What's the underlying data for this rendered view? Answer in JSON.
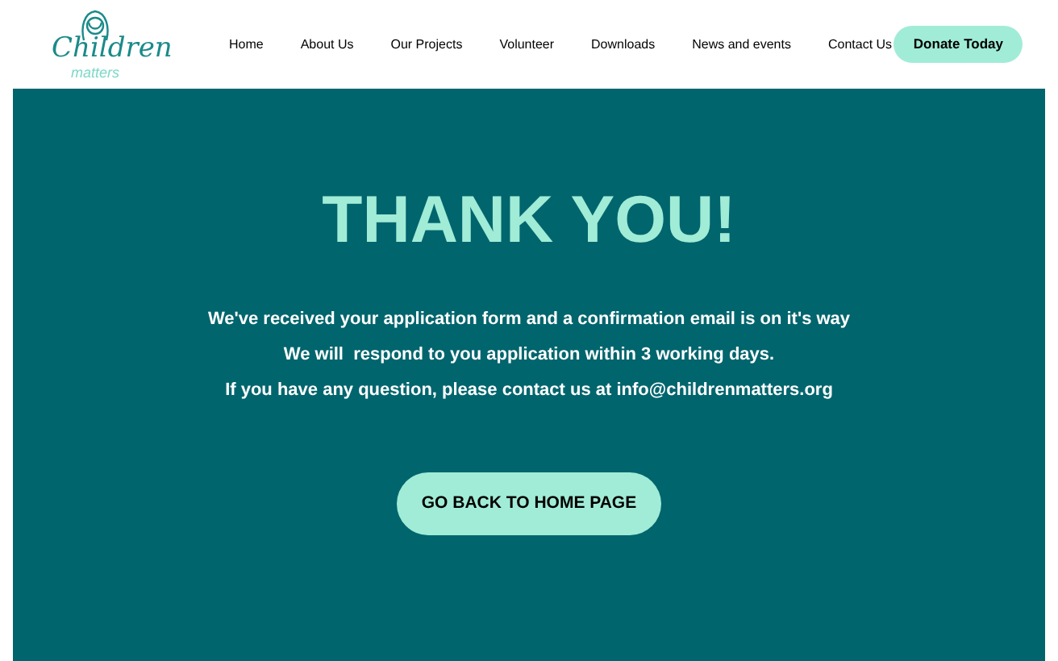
{
  "logo": {
    "line_1": "Children",
    "line_2": "matters"
  },
  "nav": [
    {
      "label": "Home"
    },
    {
      "label": "About Us"
    },
    {
      "label": "Our Projects"
    },
    {
      "label": "Volunteer"
    },
    {
      "label": "Downloads"
    },
    {
      "label": "News and events"
    },
    {
      "label": "Contact Us"
    }
  ],
  "donate_button": "Donate Today",
  "heading": "THANK YOU!",
  "messages": [
    "We've received your application form and a confirmation email is on it's way",
    "We will  respond to you application within 3 working days.",
    "If you have any question, please contact us at info@childrenmatters.org"
  ],
  "home_button": "GO BACK TO HOME PAGE"
}
